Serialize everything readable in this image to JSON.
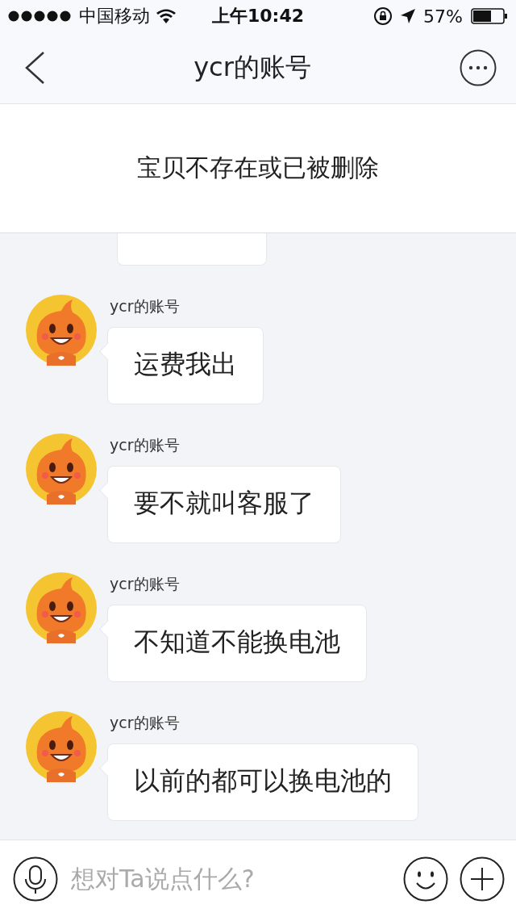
{
  "status_bar": {
    "carrier": "中国移动",
    "time": "上午10:42",
    "battery_percent": "57%"
  },
  "nav": {
    "title": "ycr的账号"
  },
  "banner": {
    "text": "宝贝不存在或已被删除"
  },
  "messages": [
    {
      "sender": "ycr的账号",
      "text": "运费我出"
    },
    {
      "sender": "ycr的账号",
      "text": "要不就叫客服了"
    },
    {
      "sender": "ycr的账号",
      "text": "不知道不能换电池"
    },
    {
      "sender": "ycr的账号",
      "text": "以前的都可以换电池的"
    }
  ],
  "input": {
    "placeholder": "想对Ta说点什么?"
  }
}
